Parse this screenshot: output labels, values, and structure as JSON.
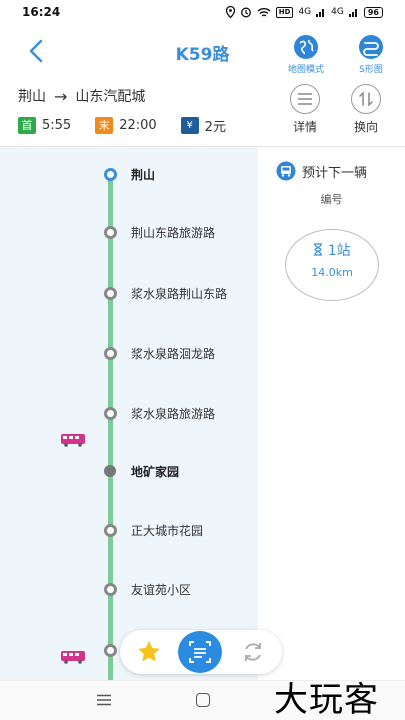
{
  "status": {
    "time": "16:24",
    "hd": "HD",
    "signal1": "4G",
    "signal2": "4G",
    "battery": "96"
  },
  "header": {
    "title": "K59路",
    "map_mode_label": "地图模式",
    "s_map_label": "S形图"
  },
  "route": {
    "from": "荆山",
    "to": "山东汽配城",
    "arrow": "→"
  },
  "times": {
    "first_tag": "首",
    "first_time": "5:55",
    "last_tag": "末",
    "last_time": "22:00",
    "fare_tag": "¥",
    "fare": "2元"
  },
  "actions": {
    "detail_label": "详情",
    "reverse_label": "换向"
  },
  "stops": [
    {
      "name": "荆山"
    },
    {
      "name": "荆山东路旅游路"
    },
    {
      "name": "浆水泉路荆山东路"
    },
    {
      "name": "浆水泉路洄龙路"
    },
    {
      "name": "浆水泉路旅游路"
    },
    {
      "name": "地矿家园"
    },
    {
      "name": "正大城市花园"
    },
    {
      "name": "友谊苑小区"
    }
  ],
  "next_bus": {
    "title": "预计下一辆",
    "sub": "编号",
    "stations": "1站",
    "distance": "14.0km"
  },
  "watermark": "大玩客",
  "colors": {
    "accent": "#3a8fd8",
    "line": "#7dcc98",
    "bus": "#d1348a"
  }
}
